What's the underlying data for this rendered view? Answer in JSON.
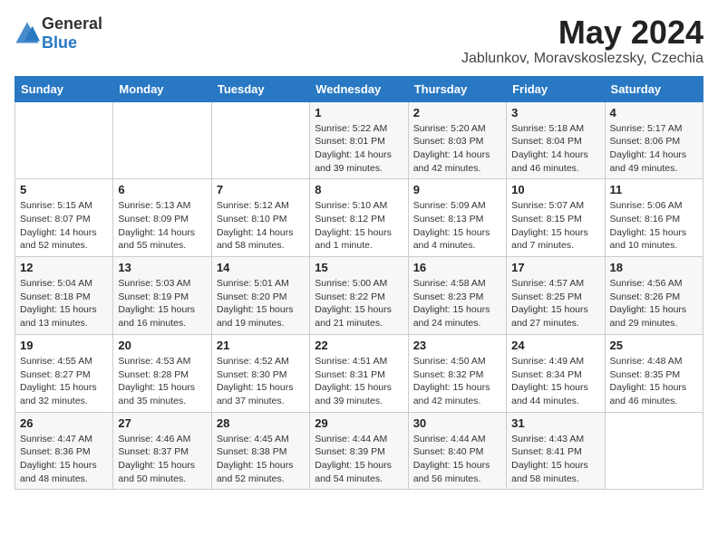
{
  "header": {
    "logo_general": "General",
    "logo_blue": "Blue",
    "month_title": "May 2024",
    "location": "Jablunkov, Moravskoslezsky, Czechia"
  },
  "days_of_week": [
    "Sunday",
    "Monday",
    "Tuesday",
    "Wednesday",
    "Thursday",
    "Friday",
    "Saturday"
  ],
  "weeks": [
    [
      {
        "day": "",
        "info": ""
      },
      {
        "day": "",
        "info": ""
      },
      {
        "day": "",
        "info": ""
      },
      {
        "day": "1",
        "info": "Sunrise: 5:22 AM\nSunset: 8:01 PM\nDaylight: 14 hours and 39 minutes."
      },
      {
        "day": "2",
        "info": "Sunrise: 5:20 AM\nSunset: 8:03 PM\nDaylight: 14 hours and 42 minutes."
      },
      {
        "day": "3",
        "info": "Sunrise: 5:18 AM\nSunset: 8:04 PM\nDaylight: 14 hours and 46 minutes."
      },
      {
        "day": "4",
        "info": "Sunrise: 5:17 AM\nSunset: 8:06 PM\nDaylight: 14 hours and 49 minutes."
      }
    ],
    [
      {
        "day": "5",
        "info": "Sunrise: 5:15 AM\nSunset: 8:07 PM\nDaylight: 14 hours and 52 minutes."
      },
      {
        "day": "6",
        "info": "Sunrise: 5:13 AM\nSunset: 8:09 PM\nDaylight: 14 hours and 55 minutes."
      },
      {
        "day": "7",
        "info": "Sunrise: 5:12 AM\nSunset: 8:10 PM\nDaylight: 14 hours and 58 minutes."
      },
      {
        "day": "8",
        "info": "Sunrise: 5:10 AM\nSunset: 8:12 PM\nDaylight: 15 hours and 1 minute."
      },
      {
        "day": "9",
        "info": "Sunrise: 5:09 AM\nSunset: 8:13 PM\nDaylight: 15 hours and 4 minutes."
      },
      {
        "day": "10",
        "info": "Sunrise: 5:07 AM\nSunset: 8:15 PM\nDaylight: 15 hours and 7 minutes."
      },
      {
        "day": "11",
        "info": "Sunrise: 5:06 AM\nSunset: 8:16 PM\nDaylight: 15 hours and 10 minutes."
      }
    ],
    [
      {
        "day": "12",
        "info": "Sunrise: 5:04 AM\nSunset: 8:18 PM\nDaylight: 15 hours and 13 minutes."
      },
      {
        "day": "13",
        "info": "Sunrise: 5:03 AM\nSunset: 8:19 PM\nDaylight: 15 hours and 16 minutes."
      },
      {
        "day": "14",
        "info": "Sunrise: 5:01 AM\nSunset: 8:20 PM\nDaylight: 15 hours and 19 minutes."
      },
      {
        "day": "15",
        "info": "Sunrise: 5:00 AM\nSunset: 8:22 PM\nDaylight: 15 hours and 21 minutes."
      },
      {
        "day": "16",
        "info": "Sunrise: 4:58 AM\nSunset: 8:23 PM\nDaylight: 15 hours and 24 minutes."
      },
      {
        "day": "17",
        "info": "Sunrise: 4:57 AM\nSunset: 8:25 PM\nDaylight: 15 hours and 27 minutes."
      },
      {
        "day": "18",
        "info": "Sunrise: 4:56 AM\nSunset: 8:26 PM\nDaylight: 15 hours and 29 minutes."
      }
    ],
    [
      {
        "day": "19",
        "info": "Sunrise: 4:55 AM\nSunset: 8:27 PM\nDaylight: 15 hours and 32 minutes."
      },
      {
        "day": "20",
        "info": "Sunrise: 4:53 AM\nSunset: 8:28 PM\nDaylight: 15 hours and 35 minutes."
      },
      {
        "day": "21",
        "info": "Sunrise: 4:52 AM\nSunset: 8:30 PM\nDaylight: 15 hours and 37 minutes."
      },
      {
        "day": "22",
        "info": "Sunrise: 4:51 AM\nSunset: 8:31 PM\nDaylight: 15 hours and 39 minutes."
      },
      {
        "day": "23",
        "info": "Sunrise: 4:50 AM\nSunset: 8:32 PM\nDaylight: 15 hours and 42 minutes."
      },
      {
        "day": "24",
        "info": "Sunrise: 4:49 AM\nSunset: 8:34 PM\nDaylight: 15 hours and 44 minutes."
      },
      {
        "day": "25",
        "info": "Sunrise: 4:48 AM\nSunset: 8:35 PM\nDaylight: 15 hours and 46 minutes."
      }
    ],
    [
      {
        "day": "26",
        "info": "Sunrise: 4:47 AM\nSunset: 8:36 PM\nDaylight: 15 hours and 48 minutes."
      },
      {
        "day": "27",
        "info": "Sunrise: 4:46 AM\nSunset: 8:37 PM\nDaylight: 15 hours and 50 minutes."
      },
      {
        "day": "28",
        "info": "Sunrise: 4:45 AM\nSunset: 8:38 PM\nDaylight: 15 hours and 52 minutes."
      },
      {
        "day": "29",
        "info": "Sunrise: 4:44 AM\nSunset: 8:39 PM\nDaylight: 15 hours and 54 minutes."
      },
      {
        "day": "30",
        "info": "Sunrise: 4:44 AM\nSunset: 8:40 PM\nDaylight: 15 hours and 56 minutes."
      },
      {
        "day": "31",
        "info": "Sunrise: 4:43 AM\nSunset: 8:41 PM\nDaylight: 15 hours and 58 minutes."
      },
      {
        "day": "",
        "info": ""
      }
    ]
  ]
}
